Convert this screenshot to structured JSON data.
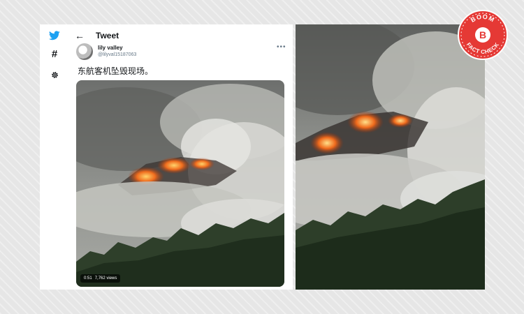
{
  "tweet": {
    "header_title": "Tweet",
    "display_name": "lily valley",
    "handle": "@lilyval15187063",
    "text": "东航客机坠毁现场。",
    "video_duration": "0:51",
    "video_views": "7,762 views"
  },
  "badge": {
    "top_text": "BOOM",
    "letter": "B",
    "bottom_text": "FACT CHECK"
  },
  "icons": {
    "logo": "bird-icon",
    "explore": "hashtag-icon",
    "settings": "gear-icon",
    "back": "back-arrow-icon",
    "more": "more-icon"
  },
  "colors": {
    "twitter_blue": "#1da1f2",
    "badge_red": "#e53935",
    "text_dark": "#14171a",
    "text_gray": "#657786"
  }
}
